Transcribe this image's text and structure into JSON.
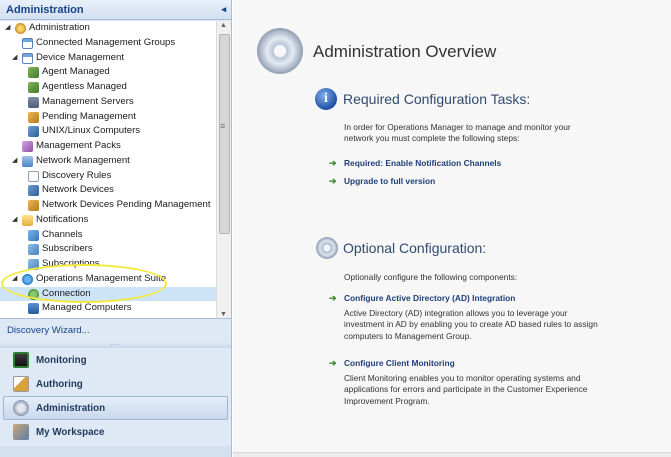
{
  "nav": {
    "header_title": "Administration",
    "collapse_glyph": "◂",
    "tree": [
      {
        "label": "Administration",
        "depth": 0,
        "expanded": true,
        "icon": "gear-icon"
      },
      {
        "label": "Connected Management Groups",
        "depth": 1,
        "icon": "window-icon"
      },
      {
        "label": "Device Management",
        "depth": 1,
        "expanded": true,
        "icon": "window-icon"
      },
      {
        "label": "Agent Managed",
        "depth": 2,
        "icon": "agent-icon"
      },
      {
        "label": "Agentless Managed",
        "depth": 2,
        "icon": "agent-icon"
      },
      {
        "label": "Management Servers",
        "depth": 2,
        "icon": "server-icon"
      },
      {
        "label": "Pending Management",
        "depth": 2,
        "icon": "pending-icon"
      },
      {
        "label": "UNIX/Linux Computers",
        "depth": 2,
        "icon": "device-icon"
      },
      {
        "label": "Management Packs",
        "depth": 1,
        "icon": "pack-icon"
      },
      {
        "label": "Network Management",
        "depth": 1,
        "expanded": true,
        "icon": "network-folder-icon"
      },
      {
        "label": "Discovery Rules",
        "depth": 2,
        "icon": "document-icon"
      },
      {
        "label": "Network Devices",
        "depth": 2,
        "icon": "device-icon"
      },
      {
        "label": "Network Devices Pending Management",
        "depth": 2,
        "icon": "pending-icon"
      },
      {
        "label": "Notifications",
        "depth": 1,
        "expanded": true,
        "icon": "folder-icon"
      },
      {
        "label": "Channels",
        "depth": 2,
        "icon": "channel-icon"
      },
      {
        "label": "Subscribers",
        "depth": 2,
        "icon": "subscriber-icon"
      },
      {
        "label": "Subscriptions",
        "depth": 2,
        "icon": "subscription-icon"
      },
      {
        "label": "Operations Management Suite",
        "depth": 1,
        "expanded": true,
        "icon": "oms-icon"
      },
      {
        "label": "Connection",
        "depth": 2,
        "icon": "connection-icon",
        "selected": true
      },
      {
        "label": "Managed Computers",
        "depth": 2,
        "icon": "computers-icon"
      }
    ],
    "wizard_link": "Discovery Wizard...",
    "wunderbar": [
      {
        "label": "Monitoring",
        "icon": "monitoring-icon",
        "active": false
      },
      {
        "label": "Authoring",
        "icon": "authoring-icon",
        "active": false
      },
      {
        "label": "Administration",
        "icon": "administration-icon",
        "active": true
      },
      {
        "label": "My Workspace",
        "icon": "my-workspace-icon",
        "active": false
      }
    ]
  },
  "main": {
    "title": "Administration Overview",
    "required": {
      "heading": "Required Configuration Tasks:",
      "intro": "In order for Operations Manager to manage and monitor your network you must complete the following steps:",
      "tasks": [
        "Required: Enable Notification Channels",
        "Upgrade to full version"
      ]
    },
    "optional": {
      "heading": "Optional Configuration:",
      "intro": "Optionally configure the following components:",
      "items": [
        {
          "title": "Configure Active Directory (AD) Integration",
          "desc": "Active Directory (AD) integration allows you to leverage your investment in AD by enabling you to create AD based rules to assign computers to Management Group."
        },
        {
          "title": "Configure Client Monitoring",
          "desc": "Client Monitoring enables you to monitor operating systems and applications for errors and participate in the Customer Experience Improvement Program."
        }
      ]
    }
  },
  "colors": {
    "nav_background": "#dfe9f5",
    "accent_blue": "#15428b",
    "annotation_highlight": "#f3e93c",
    "task_arrow": "#3a8a2b"
  }
}
